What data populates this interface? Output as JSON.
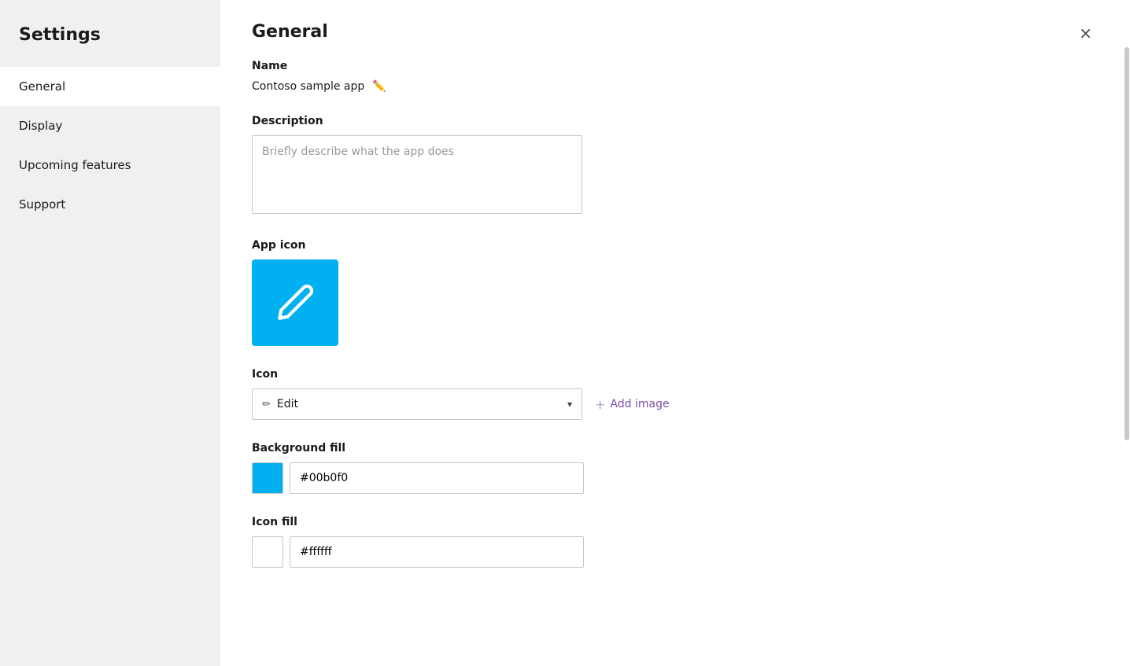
{
  "sidebar": {
    "title": "Settings",
    "items": [
      {
        "id": "general",
        "label": "General",
        "active": true
      },
      {
        "id": "display",
        "label": "Display",
        "active": false
      },
      {
        "id": "upcoming-features",
        "label": "Upcoming features",
        "active": false
      },
      {
        "id": "support",
        "label": "Support",
        "active": false
      }
    ]
  },
  "main": {
    "title": "General",
    "close_label": "×",
    "sections": {
      "name": {
        "label": "Name",
        "value": "Contoso sample app"
      },
      "description": {
        "label": "Description",
        "placeholder": "Briefly describe what the app does"
      },
      "app_icon": {
        "label": "App icon"
      },
      "icon": {
        "label": "Icon",
        "selected": "Edit",
        "add_image_label": "Add image"
      },
      "background_fill": {
        "label": "Background fill",
        "color_hex": "#00b0f0",
        "color_value": "#00b0f0"
      },
      "icon_fill": {
        "label": "Icon fill",
        "color_hex": "#ffffff",
        "color_value": "#ffffff"
      }
    }
  }
}
